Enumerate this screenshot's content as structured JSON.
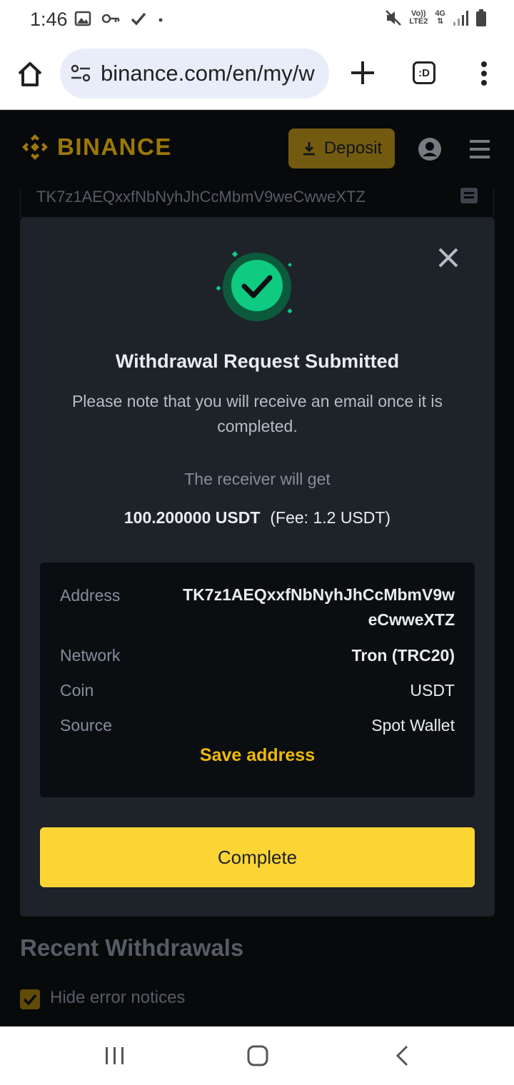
{
  "status_bar": {
    "time": "1:46",
    "volte_top": "Vo))",
    "volte_bottom": "LTE2",
    "network": "4G"
  },
  "browser": {
    "url": "binance.com/en/my/w",
    "tab_label": ":D"
  },
  "header": {
    "brand": "BINANCE",
    "deposit_label": "Deposit"
  },
  "background": {
    "address_field": "TK7z1AEQxxfNbNyhJhCcMbmV9weCwweXTZ",
    "recent_title": "Recent Withdrawals",
    "hide_errors_label": "Hide error notices"
  },
  "modal": {
    "title": "Withdrawal Request Submitted",
    "note": "Please note that you will receive an email once it is completed.",
    "receiver_label": "The receiver will get",
    "amount": "100.200000 USDT",
    "fee": "(Fee: 1.2 USDT)",
    "details": {
      "address_label": "Address",
      "address_value_line1": "TK7z1AEQxxfNbNyhJhCcMbmV9w",
      "address_value_line2": "eCwweXTZ",
      "network_label": "Network",
      "network_value": "Tron (TRC20)",
      "coin_label": "Coin",
      "coin_value": "USDT",
      "source_label": "Source",
      "source_value": "Spot Wallet"
    },
    "save_address_label": "Save address",
    "complete_label": "Complete"
  },
  "colors": {
    "accent_yellow": "#FCD535",
    "brand_gold": "#F0B90B",
    "success_green": "#0ECB81"
  }
}
